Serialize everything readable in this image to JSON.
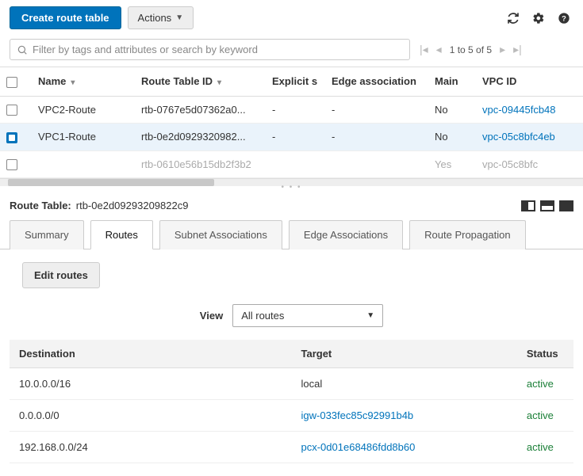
{
  "toolbar": {
    "create_label": "Create route table",
    "actions_label": "Actions"
  },
  "search": {
    "placeholder": "Filter by tags and attributes or search by keyword"
  },
  "paginator": {
    "label": "1 to 5 of 5"
  },
  "columns": {
    "name": "Name",
    "route_table_id": "Route Table ID",
    "explicit": "Explicit s",
    "edge_assoc": "Edge association",
    "main": "Main",
    "vpc_id": "VPC ID"
  },
  "rows": [
    {
      "selected": false,
      "name": "VPC2-Route",
      "rtb": "rtb-0767e5d07362a0...",
      "explicit": "-",
      "edge": "-",
      "main": "No",
      "vpc": "vpc-09445fcb48",
      "dimmed": false
    },
    {
      "selected": true,
      "name": "VPC1-Route",
      "rtb": "rtb-0e2d0929320982...",
      "explicit": "-",
      "edge": "-",
      "main": "No",
      "vpc": "vpc-05c8bfc4eb",
      "dimmed": false
    },
    {
      "selected": false,
      "name": "",
      "rtb": "rtb-0610e56b15db2f3b2",
      "explicit": "",
      "edge": "",
      "main": "Yes",
      "vpc": "vpc-05c8bfc",
      "dimmed": true
    }
  ],
  "detail": {
    "label": "Route Table:",
    "value": "rtb-0e2d09293209822c9"
  },
  "tabs": {
    "summary": "Summary",
    "routes": "Routes",
    "subnet_assoc": "Subnet Associations",
    "edge_assoc": "Edge Associations",
    "route_prop": "Route Propagation"
  },
  "edit_routes_label": "Edit routes",
  "view": {
    "label": "View",
    "selected": "All routes"
  },
  "routes_columns": {
    "destination": "Destination",
    "target": "Target",
    "status": "Status"
  },
  "routes": [
    {
      "destination": "10.0.0.0/16",
      "target": "local",
      "target_link": false,
      "status": "active"
    },
    {
      "destination": "0.0.0.0/0",
      "target": "igw-033fec85c92991b4b",
      "target_link": true,
      "status": "active"
    },
    {
      "destination": "192.168.0.0/24",
      "target": "pcx-0d01e68486fdd8b60",
      "target_link": true,
      "status": "active"
    }
  ]
}
